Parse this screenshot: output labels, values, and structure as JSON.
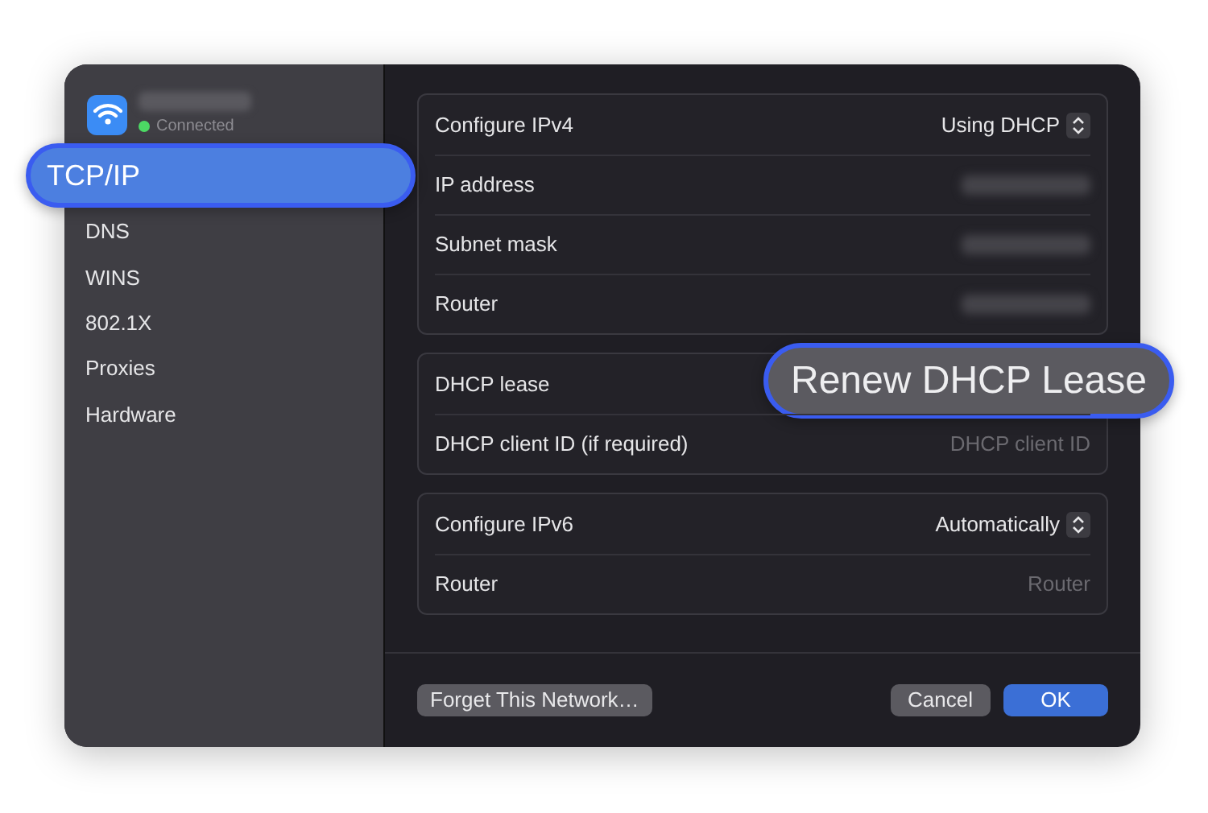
{
  "network": {
    "status": "Connected",
    "connected": true
  },
  "sidebar": {
    "items": [
      {
        "label": "TCP/IP",
        "selected": true
      },
      {
        "label": "DNS",
        "selected": false
      },
      {
        "label": "WINS",
        "selected": false
      },
      {
        "label": "802.1X",
        "selected": false
      },
      {
        "label": "Proxies",
        "selected": false
      },
      {
        "label": "Hardware",
        "selected": false
      }
    ]
  },
  "sections": [
    {
      "rows": [
        {
          "label": "Configure IPv4",
          "kind": "popup",
          "value": "Using DHCP"
        },
        {
          "label": "IP address",
          "kind": "blurred"
        },
        {
          "label": "Subnet mask",
          "kind": "blurred"
        },
        {
          "label": "Router",
          "kind": "blurred"
        }
      ]
    },
    {
      "rows": [
        {
          "label": "DHCP lease",
          "kind": "button",
          "value": "Renew DHCP Lease"
        },
        {
          "label": "DHCP client ID (if required)",
          "kind": "field",
          "placeholder": "DHCP client ID"
        }
      ]
    },
    {
      "rows": [
        {
          "label": "Configure IPv6",
          "kind": "popup",
          "value": "Automatically"
        },
        {
          "label": "Router",
          "kind": "field",
          "placeholder": "Router"
        }
      ]
    }
  ],
  "footer": {
    "left_button": "Forget This Network…",
    "buttons": [
      {
        "label": "Cancel",
        "default": false
      },
      {
        "label": "OK",
        "default": true
      }
    ]
  }
}
